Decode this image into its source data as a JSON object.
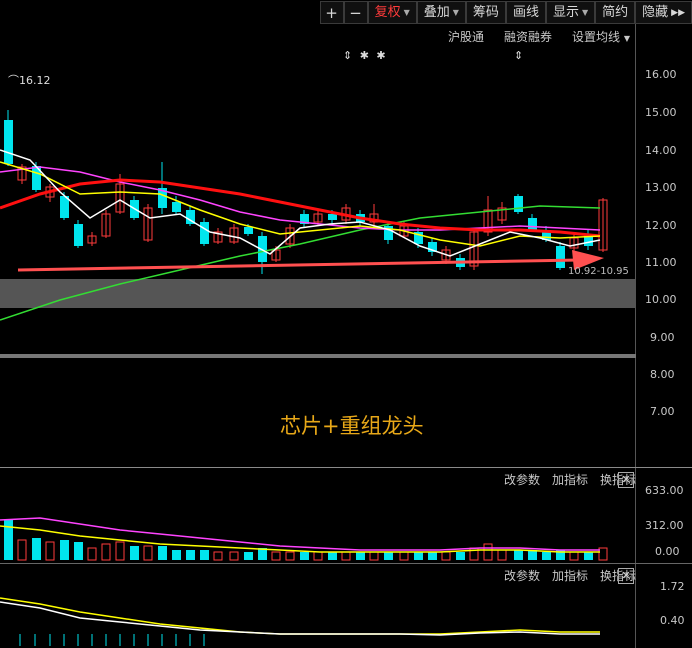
{
  "toolbar": {
    "plus": "+",
    "minus": "−",
    "fuquan": "复权",
    "diejia": "叠加",
    "chouma": "筹码",
    "huaxian": "画线",
    "xianshi": "显示",
    "jianyue": "简约",
    "yincang": "隐藏"
  },
  "subbar": {
    "hugutong": "沪股通",
    "rongzi": "融资融券",
    "junxian": "设置均线"
  },
  "markers": {
    "stars": "⇕ ✱ ✱",
    "single": "⇕"
  },
  "main": {
    "high_label": "16.12",
    "range_label": "10.92-10.95",
    "caption": "芯片+重组龙头",
    "yaxis": [
      "16.00",
      "15.00",
      "14.00",
      "13.00",
      "12.00",
      "11.00",
      "10.00",
      "9.00",
      "8.00",
      "7.00"
    ]
  },
  "volume": {
    "controls": [
      "改参数",
      "加指标",
      "换指标"
    ],
    "yaxis": [
      "633.00",
      "312.00",
      "0.00"
    ]
  },
  "indicator": {
    "controls": [
      "改参数",
      "加指标",
      "换指标"
    ],
    "yaxis": [
      "1.72",
      "0.40"
    ]
  },
  "colors": {
    "up": "#ff3b3b",
    "down": "#00e5ee",
    "ma5": "#ffffff",
    "ma10": "#ffff00",
    "ma20": "#ff44ff",
    "ma60": "#33dd33",
    "ma30": "#ff1010",
    "accent": "#e8a818"
  },
  "close_glyph": "✕"
}
